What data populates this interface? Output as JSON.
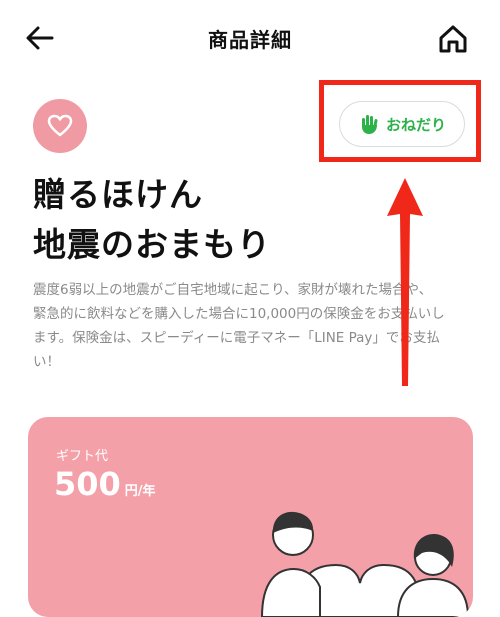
{
  "header": {
    "title": "商品詳細",
    "back_icon": "arrow-left-icon",
    "home_icon": "home-icon"
  },
  "favorite_icon": "heart-icon",
  "onedari_button": {
    "label": "おねだり",
    "icon": "hand-icon",
    "color": "#2db24a",
    "highlight_color": "#f0281a"
  },
  "product": {
    "title_lines": [
      "贈るほけん",
      "地震のおまもり"
    ],
    "description": "震度6弱以上の地震がご自宅地域に起こり、家財が壊れた場合や、緊急的に飲料などを購入した場合に10,000円の保険金をお支払いします。保険金は、スピーディーに電子マネー「LINE Pay」でお支払い！"
  },
  "gift": {
    "label": "ギフト代",
    "price": "500",
    "unit": "円/年",
    "card_color": "#f4a0a9"
  },
  "colors": {
    "accent_pink": "#f09aa3",
    "annotation_red": "#f0281a"
  }
}
